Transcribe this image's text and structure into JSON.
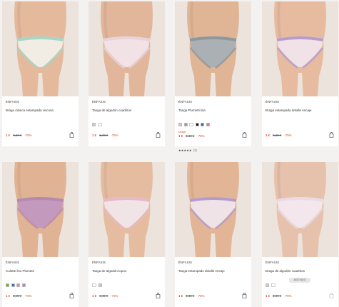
{
  "products": [
    {
      "brand": "ÉNFASIS",
      "name": "Braga clásica estampada viscosa",
      "swatches": [],
      "price": "1 €",
      "old_price": "3,49 €",
      "discount": "-75%",
      "rating": null,
      "rating_count": null,
      "stock_label": null,
      "desde": null,
      "colors": {
        "skin": "#e4b99c",
        "fabric": "#f1ece4",
        "trim": "#a6d6c4"
      }
    },
    {
      "brand": "ÉNFASIS",
      "name": "Tanga de algodón cuadritos",
      "swatches": [
        "#cfcfcf",
        "more"
      ],
      "price": "1 €",
      "old_price": "3,49 €",
      "discount": "-75%",
      "rating": null,
      "rating_count": null,
      "stock_label": null,
      "desde": null,
      "colors": {
        "skin": "#e2b69a",
        "fabric": "#f2e2e6",
        "trim": "#e8d3dc"
      }
    },
    {
      "brand": "ÉNFASIS",
      "name": "Tanga Plumetti lisa",
      "swatches": [
        "#f2b7a8",
        "#9a9a9a",
        "more",
        "#1b1b1b",
        "#2369b8",
        "#e86aa6"
      ],
      "price": "1 €",
      "old_price": "3,49 €",
      "discount": "-75%",
      "rating": "★★★★★",
      "rating_count": "(3)",
      "stock_label": null,
      "desde": "Desde",
      "colors": {
        "skin": "#e0b596",
        "fabric": "#aab0b4",
        "trim": "#8e979d"
      }
    },
    {
      "brand": "ÉNFASIS",
      "name": "Braga estampada detalle encaje",
      "swatches": [],
      "price": "1 €",
      "old_price": "3,49 €",
      "discount": "-75%",
      "rating": null,
      "rating_count": null,
      "stock_label": null,
      "desde": null,
      "colors": {
        "skin": "#e6bba0",
        "fabric": "#f0e2e6",
        "trim": "#b79ccc"
      }
    },
    {
      "brand": "ÉNFASIS",
      "name": "Culotte liso Plumetti",
      "swatches": [
        "#6fae3c",
        "#2477c4",
        "#e687b7",
        "#a985c9"
      ],
      "price": "1 €",
      "old_price": "3,49 €",
      "discount": "-75%",
      "rating": null,
      "rating_count": null,
      "stock_label": null,
      "desde": null,
      "colors": {
        "skin": "#e0b394",
        "fabric": "#c499be",
        "trim": "#b48aae"
      }
    },
    {
      "brand": "ÉNFASIS",
      "name": "Tanga de algodón topos",
      "swatches": [
        "more",
        "#c8c8c8"
      ],
      "price": "1 €",
      "old_price": "3,49 €",
      "discount": "-75%",
      "rating": null,
      "rating_count": null,
      "stock_label": null,
      "desde": null,
      "colors": {
        "skin": "#e6bca0",
        "fabric": "#f1e4e6",
        "trim": "#e5b9c7"
      }
    },
    {
      "brand": "ÉNFASIS",
      "name": "Tanga estampado detalle encaje",
      "swatches": [],
      "price": "1 €",
      "old_price": "3,49 €",
      "discount": "-75%",
      "rating": null,
      "rating_count": null,
      "stock_label": null,
      "desde": null,
      "colors": {
        "skin": "#e2b596",
        "fabric": "#efe3e7",
        "trim": "#b59bc9"
      }
    },
    {
      "brand": "ÉNFASIS",
      "name": "Braga de algodón cuadritos",
      "swatches": [
        "#cfcfcf",
        "more"
      ],
      "price": "1 €",
      "old_price": "3,49 €",
      "discount": "-75%",
      "rating": null,
      "rating_count": null,
      "stock_label": "AGOTADO",
      "desde": null,
      "colors": {
        "skin": "#e6c1ab",
        "fabric": "#f3e7ed",
        "trim": "#eadbe4"
      }
    }
  ]
}
